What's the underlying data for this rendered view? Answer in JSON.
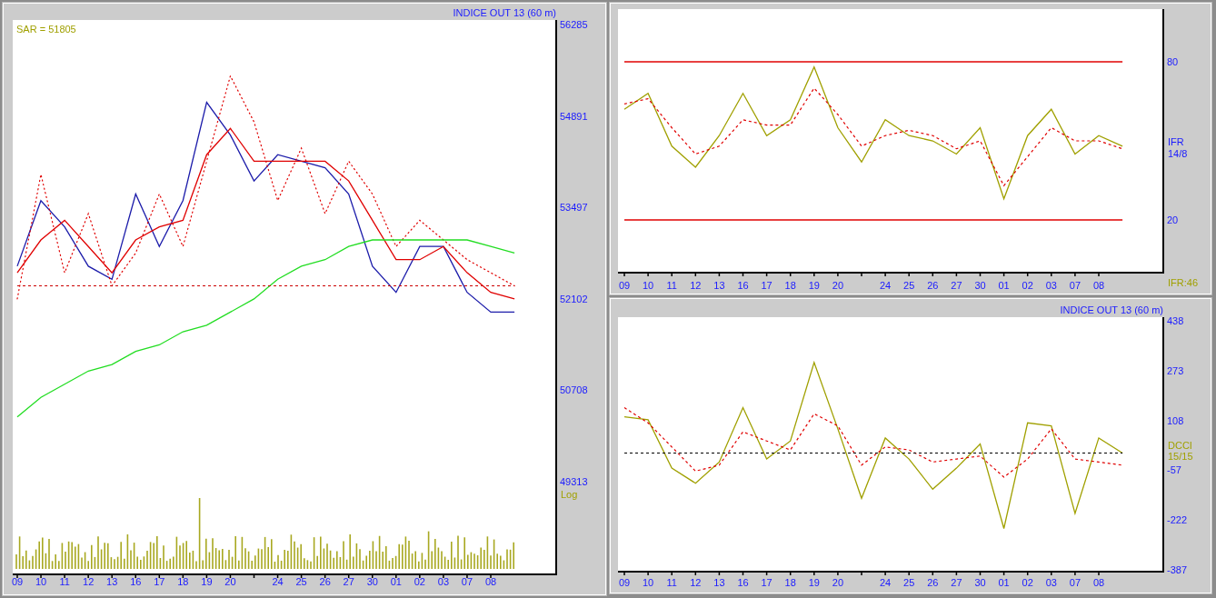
{
  "price_panel": {
    "title": "INDICE OUT 13 (60 m)",
    "legend": "SAR = 51805",
    "scale_note": "Log",
    "chart_data": {
      "type": "line",
      "categories": [
        "09",
        "10",
        "11",
        "12",
        "13",
        "16",
        "17",
        "18",
        "19",
        "20",
        null,
        "24",
        "25",
        "26",
        "27",
        "30",
        "01",
        "02",
        "03",
        "07",
        "08",
        null
      ],
      "series": [
        {
          "color": "#1c1caa",
          "values": [
            52600,
            53600,
            53200,
            52600,
            52400,
            53700,
            52900,
            53600,
            55100,
            54600,
            53900,
            54300,
            54200,
            54100,
            53700,
            52600,
            52200,
            52900,
            52900,
            52200,
            51900,
            51900
          ]
        },
        {
          "color": "#e00000",
          "values": [
            52500,
            53000,
            53300,
            52900,
            52500,
            53000,
            53200,
            53300,
            54300,
            54700,
            54200,
            54200,
            54200,
            54200,
            53900,
            53300,
            52700,
            52700,
            52900,
            52500,
            52200,
            52100
          ]
        },
        {
          "color": "#e00000",
          "line_style": "dotted",
          "values": [
            52100,
            54000,
            52500,
            53400,
            52300,
            52800,
            53700,
            52900,
            54200,
            55500,
            54800,
            53600,
            54400,
            53400,
            54200,
            53700,
            52900,
            53300,
            53000,
            52700,
            52500,
            52300
          ]
        },
        {
          "color": "#22dd22",
          "values": [
            50300,
            50600,
            50800,
            51000,
            51100,
            51300,
            51400,
            51600,
            51700,
            51900,
            52100,
            52400,
            52600,
            52700,
            52900,
            53000,
            53000,
            53000,
            53000,
            53000,
            52900,
            52800
          ]
        },
        {
          "color": "#cc0000",
          "line_style": "dashed",
          "values": [
            52300,
            52300,
            52300,
            52300,
            52300,
            52300,
            52300,
            52300,
            52300,
            52300,
            52300,
            52300,
            52300,
            52300,
            52300,
            52300,
            52300,
            52300,
            52300,
            52300,
            52300,
            52300
          ]
        }
      ],
      "ylim": [
        47900,
        56354
      ],
      "yticks": [
        56285,
        54891,
        53497,
        52102,
        50708,
        49313
      ]
    }
  },
  "rsi_panel": {
    "label_lines": [
      "IFR",
      "14/8"
    ],
    "reading": "IFR:46",
    "chart_data": {
      "type": "line",
      "categories": [
        "09",
        "10",
        "11",
        "12",
        "13",
        "16",
        "17",
        "18",
        "19",
        "20",
        null,
        "24",
        "25",
        "26",
        "27",
        "30",
        "01",
        "02",
        "03",
        "07",
        "08",
        null
      ],
      "series": [
        {
          "color": "#a0a000",
          "values": [
            62,
            68,
            48,
            40,
            52,
            68,
            52,
            58,
            78,
            55,
            42,
            58,
            52,
            50,
            45,
            55,
            28,
            52,
            62,
            45,
            52,
            48
          ]
        },
        {
          "color": "#e00000",
          "line_style": "dashed",
          "values": [
            64,
            66,
            55,
            45,
            48,
            58,
            56,
            56,
            70,
            60,
            48,
            52,
            54,
            52,
            47,
            50,
            33,
            44,
            55,
            50,
            50,
            47
          ]
        },
        {
          "color": "#e00000",
          "values": [
            80,
            80,
            80,
            80,
            80,
            80,
            80,
            80,
            80,
            80,
            80,
            80,
            80,
            80,
            80,
            80,
            80,
            80,
            80,
            80,
            80,
            80
          ]
        },
        {
          "color": "#e00000",
          "values": [
            20,
            20,
            20,
            20,
            20,
            20,
            20,
            20,
            20,
            20,
            20,
            20,
            20,
            20,
            20,
            20,
            20,
            20,
            20,
            20,
            20,
            20
          ]
        }
      ],
      "ylim": [
        0,
        100
      ],
      "yticks": [
        80,
        20
      ]
    }
  },
  "cci_panel": {
    "title": "INDICE OUT 13 (60 m)",
    "label_lines": [
      "DCCI",
      "15/15"
    ],
    "chart_data": {
      "type": "line",
      "categories": [
        "09",
        "10",
        "11",
        "12",
        "13",
        "16",
        "17",
        "18",
        "19",
        "20",
        null,
        "24",
        "25",
        "26",
        "27",
        "30",
        "01",
        "02",
        "03",
        "07",
        "08",
        null
      ],
      "series": [
        {
          "color": "#a0a000",
          "values": [
            120,
            110,
            -50,
            -100,
            -30,
            150,
            -20,
            40,
            300,
            80,
            -150,
            50,
            -20,
            -120,
            -50,
            30,
            -250,
            100,
            90,
            -200,
            50,
            0
          ]
        },
        {
          "color": "#e00000",
          "line_style": "dashed",
          "values": [
            150,
            100,
            20,
            -60,
            -40,
            70,
            40,
            10,
            130,
            90,
            -40,
            20,
            10,
            -30,
            -20,
            -10,
            -80,
            -20,
            80,
            -20,
            -30,
            -40
          ]
        },
        {
          "color": "#000000",
          "line_style": "dashed",
          "values": [
            0,
            0,
            0,
            0,
            0,
            0,
            0,
            0,
            0,
            0,
            0,
            0,
            0,
            0,
            0,
            0,
            0,
            0,
            0,
            0,
            0,
            0
          ]
        }
      ],
      "ylim": [
        -393,
        450
      ],
      "yticks": [
        438,
        273,
        108,
        -57,
        -222,
        -387
      ]
    }
  }
}
